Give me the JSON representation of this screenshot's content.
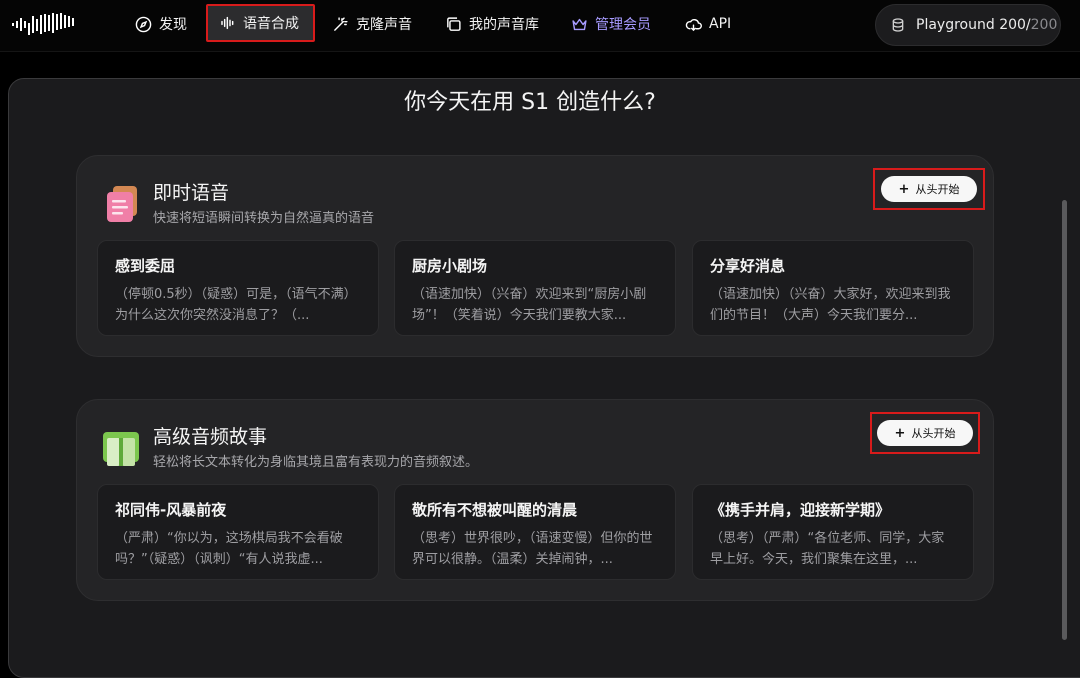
{
  "nav": {
    "items": [
      {
        "label": "发现",
        "icon": "compass-icon"
      },
      {
        "label": "语音合成",
        "icon": "waveform-icon"
      },
      {
        "label": "克隆声音",
        "icon": "magic-wand-icon"
      },
      {
        "label": "我的声音库",
        "icon": "library-icon"
      },
      {
        "label": "管理会员",
        "icon": "crown-icon"
      },
      {
        "label": "API",
        "icon": "cloud-icon"
      }
    ],
    "active": "语音合成",
    "member_color": "#a79bff"
  },
  "playground": {
    "label": "Playground",
    "used": "200",
    "separator": "/",
    "max": "200",
    "icon": "database-icon"
  },
  "page": {
    "title": "你今天在用 S1 创造什么?"
  },
  "sections": [
    {
      "title": "即时语音",
      "subtitle": "快速将短语瞬间转换为自然逼真的语音",
      "icon": "document-stack-icon",
      "start_label": "从头开始",
      "cards": [
        {
          "title": "感到委屈",
          "text": "（停顿0.5秒）（疑惑）可是，（语气不满）为什么这次你突然没消息了？（..."
        },
        {
          "title": "厨房小剧场",
          "text": "（语速加快）（兴奋）欢迎来到“厨房小剧场”！（笑着说）今天我们要教大家..."
        },
        {
          "title": "分享好消息",
          "text": "（语速加快）（兴奋）大家好，欢迎来到我们的节目！（大声）今天我们要分..."
        }
      ]
    },
    {
      "title": "高级音频故事",
      "subtitle": "轻松将长文本转化为身临其境且富有表现力的音频叙述。",
      "icon": "book-icon",
      "start_label": "从头开始",
      "cards": [
        {
          "title": "祁同伟-风暴前夜",
          "text": "（严肃）“你以为，这场棋局我不会看破吗？”（疑惑）（讽刺）“有人说我虚..."
        },
        {
          "title": "敬所有不想被叫醒的清晨",
          "text": "（思考）世界很吵，（语速变慢）但你的世界可以很静。（温柔）关掉闹钟，..."
        },
        {
          "title": "《携手并肩，迎接新学期》",
          "text": "（思考）（严肃）“各位老师、同学，大家早上好。今天，我们聚集在这里，..."
        }
      ]
    }
  ],
  "colors": {
    "highlight_border": "#d81b1b",
    "background": "#000000",
    "panel": "#1b1b1d",
    "section": "#242426"
  }
}
